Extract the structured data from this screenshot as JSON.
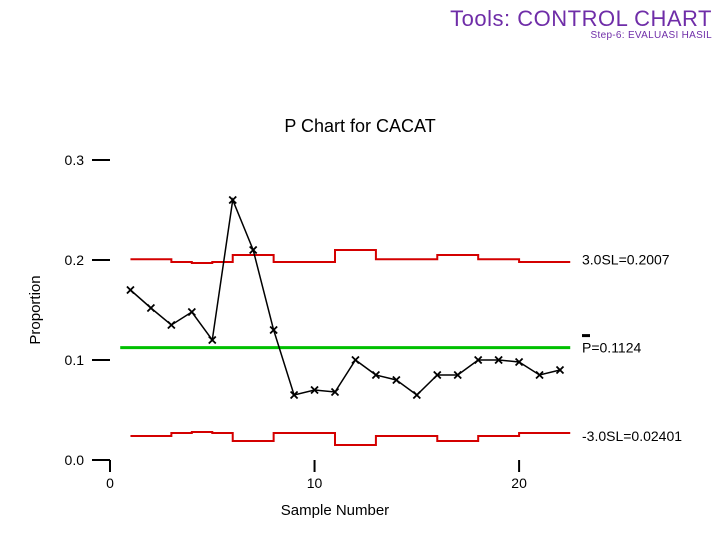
{
  "header": {
    "title": "Tools: CONTROL CHART",
    "subtitle": "Step-6: EVALUASI HASIL"
  },
  "chart_data": {
    "type": "line",
    "title": "P Chart for CACAT",
    "xlabel": "Sample Number",
    "ylabel": "Proportion",
    "xlim": [
      0,
      22
    ],
    "ylim": [
      0.0,
      0.3
    ],
    "x_ticks": [
      0,
      10,
      20
    ],
    "y_ticks": [
      0.0,
      0.1,
      0.2,
      0.3
    ],
    "y_tick_labels": [
      "0.0",
      "0.1",
      "0.2",
      "0.3"
    ],
    "series": [
      {
        "name": "Proportion",
        "color": "#000000",
        "marker": "x",
        "x": [
          1,
          2,
          3,
          4,
          5,
          6,
          7,
          8,
          9,
          10,
          11,
          12,
          13,
          14,
          15,
          16,
          17,
          18,
          19,
          20,
          21,
          22
        ],
        "y": [
          0.17,
          0.152,
          0.135,
          0.148,
          0.12,
          0.26,
          0.21,
          0.13,
          0.065,
          0.07,
          0.068,
          0.1,
          0.085,
          0.08,
          0.065,
          0.085,
          0.085,
          0.1,
          0.1,
          0.098,
          0.085,
          0.09
        ]
      }
    ],
    "center_line": {
      "value": 0.1124,
      "label": "P=0.1124",
      "color": "#00c000"
    },
    "limits": {
      "ucl": {
        "label": "3.0SL=0.2007",
        "color": "#d40000",
        "x": [
          1,
          2,
          3,
          4,
          5,
          6,
          7,
          8,
          9,
          10,
          11,
          12,
          13,
          14,
          15,
          16,
          17,
          18,
          19,
          20,
          21,
          22
        ],
        "y": [
          0.2007,
          0.2007,
          0.198,
          0.197,
          0.198,
          0.205,
          0.205,
          0.198,
          0.198,
          0.198,
          0.21,
          0.21,
          0.2007,
          0.2007,
          0.2007,
          0.205,
          0.205,
          0.2007,
          0.2007,
          0.198,
          0.198,
          0.198
        ]
      },
      "lcl": {
        "label": "-3.0SL=0.02401",
        "color": "#d40000",
        "x": [
          1,
          2,
          3,
          4,
          5,
          6,
          7,
          8,
          9,
          10,
          11,
          12,
          13,
          14,
          15,
          16,
          17,
          18,
          19,
          20,
          21,
          22
        ],
        "y": [
          0.024,
          0.024,
          0.027,
          0.028,
          0.027,
          0.019,
          0.019,
          0.027,
          0.027,
          0.027,
          0.015,
          0.015,
          0.024,
          0.024,
          0.024,
          0.019,
          0.019,
          0.024,
          0.024,
          0.027,
          0.027,
          0.027
        ]
      }
    }
  }
}
